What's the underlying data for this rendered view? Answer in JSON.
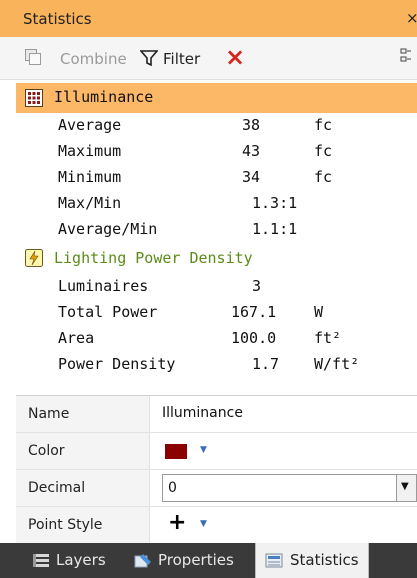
{
  "panel": {
    "title": "Statistics",
    "close_glyph": "×"
  },
  "toolbar": {
    "combine_label": "Combine",
    "filter_label": "Filter",
    "clear_icon": "×",
    "more_icon": "overflow-icon"
  },
  "statistics": {
    "illuminance": {
      "label": "Illuminance",
      "rows": [
        {
          "label": "Average",
          "value": "38",
          "unit": "fc"
        },
        {
          "label": "Maximum",
          "value": "43",
          "unit": "fc"
        },
        {
          "label": "Minimum",
          "value": "34",
          "unit": "fc"
        },
        {
          "label": "Max/Min",
          "value": "1.3:1",
          "unit": ""
        },
        {
          "label": "Average/Min",
          "value": "1.1:1",
          "unit": ""
        }
      ]
    },
    "lpd": {
      "label": "Lighting Power Density",
      "rows": [
        {
          "label": "Luminaires",
          "value": "3",
          "unit": ""
        },
        {
          "label": "Total Power",
          "value": "167.1",
          "unit": "W"
        },
        {
          "label": "Area",
          "value": "100.0",
          "unit": "ft²"
        },
        {
          "label": "Power Density",
          "value": "1.7",
          "unit": "W/ft²"
        }
      ]
    }
  },
  "properties": {
    "name_label": "Name",
    "name_value": "Illuminance",
    "color_label": "Color",
    "color_value": "#8b0000",
    "decimal_label": "Decimal",
    "decimal_value": "0",
    "point_style_label": "Point Style",
    "point_style_value": "+"
  },
  "tabs": [
    {
      "label": "Layers"
    },
    {
      "label": "Properties"
    },
    {
      "label": "Statistics",
      "active": true
    }
  ],
  "colors": {
    "title_bar": "#f9b35a",
    "selected_row": "#fcb867",
    "lpd_text": "#5b8c17",
    "clear_red": "#d9251d",
    "tab_bar": "#3a3a3a"
  }
}
